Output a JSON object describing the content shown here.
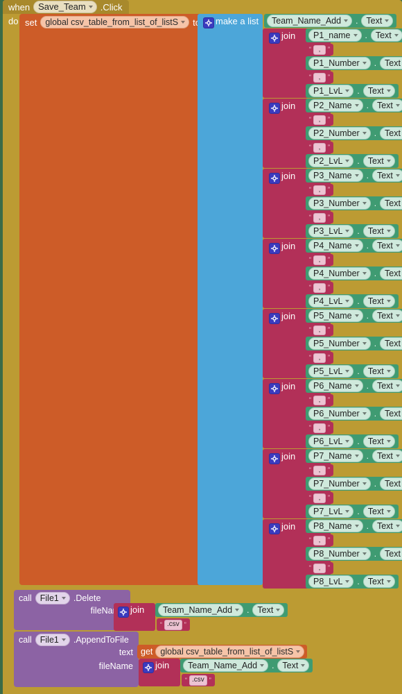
{
  "editor": {
    "name": "MIT App Inventor Blocks Editor",
    "background_color": "#3b6b47"
  },
  "colors": {
    "event_gold": "#bc9b33",
    "variable_orange": "#cd5c28",
    "list_blue": "#4ca6d9",
    "text_magenta": "#b23058",
    "component_green": "#3f9b72",
    "call_purple": "#8c63a4",
    "gear_blue": "#3b3bbf"
  },
  "event_block": {
    "when_label": "when",
    "component": "Save_Team",
    "event_suffix": ".Click",
    "do_label": "do"
  },
  "set_block": {
    "keyword": "set",
    "variable": "global csv_table_from_list_of_listS",
    "to_label": "to"
  },
  "make_a_list": {
    "label": "make a list",
    "gear_icon": "gear-icon"
  },
  "list_first_item": {
    "component": "Team_Name_Add",
    "dot": ".",
    "property": "Text"
  },
  "join_label": "join",
  "separator_text": ",",
  "join_groups": [
    {
      "label": "join",
      "name_component": "P1_name",
      "name_property": "Text",
      "sep1": ",",
      "number_component": "P1_Number",
      "number_property": "Text",
      "sep2": ",",
      "lvl_component": "P1_LvL",
      "lvl_property": "Text"
    },
    {
      "label": "join",
      "name_component": "P2_Name",
      "name_property": "Text",
      "sep1": ",",
      "number_component": "P2_Number",
      "number_property": "Text",
      "sep2": ",",
      "lvl_component": "P2_LvL",
      "lvl_property": "Text"
    },
    {
      "label": "join",
      "name_component": "P3_Name",
      "name_property": "Text",
      "sep1": ",",
      "number_component": "P3_Number",
      "number_property": "Text",
      "sep2": ",",
      "lvl_component": "P3_LvL",
      "lvl_property": "Text"
    },
    {
      "label": "join",
      "name_component": "P4_Name",
      "name_property": "Text",
      "sep1": ",",
      "number_component": "P4_Number",
      "number_property": "Text",
      "sep2": ",",
      "lvl_component": "P4_LvL",
      "lvl_property": "Text"
    },
    {
      "label": "join",
      "name_component": "P5_Name",
      "name_property": "Text",
      "sep1": ",",
      "number_component": "P5_Number",
      "number_property": "Text",
      "sep2": ",",
      "lvl_component": "P5_LvL",
      "lvl_property": "Text"
    },
    {
      "label": "join",
      "name_component": "P6_Name",
      "name_property": "Text",
      "sep1": ",",
      "number_component": "P6_Number",
      "number_property": "Text",
      "sep2": ",",
      "lvl_component": "P6_LvL",
      "lvl_property": "Text"
    },
    {
      "label": "join",
      "name_component": "P7_Name",
      "name_property": "Text",
      "sep1": ",",
      "number_component": "P7_Number",
      "number_property": "Text",
      "sep2": ",",
      "lvl_component": "P7_LvL",
      "lvl_property": "Text"
    },
    {
      "label": "join",
      "name_component": "P8_Name",
      "name_property": "Text",
      "sep1": ",",
      "number_component": "P8_Number",
      "number_property": "Text",
      "sep2": ",",
      "lvl_component": "P8_LvL",
      "lvl_property": "Text"
    }
  ],
  "delete_call": {
    "keyword": "call",
    "component": "File1",
    "method": ".Delete",
    "filename_label": "fileName",
    "join_label": "join",
    "join_component": "Team_Name_Add",
    "join_dot": ".",
    "join_property": "Text",
    "extension": ".csv"
  },
  "append_call": {
    "keyword": "call",
    "component": "File1",
    "method": ".AppendToFile",
    "text_label": "text",
    "get_keyword": "get",
    "get_variable": "global csv_table_from_list_of_listS",
    "filename_label": "fileName",
    "join_label": "join",
    "join_component": "Team_Name_Add",
    "join_dot": ".",
    "join_property": "Text",
    "extension": ".csv"
  }
}
